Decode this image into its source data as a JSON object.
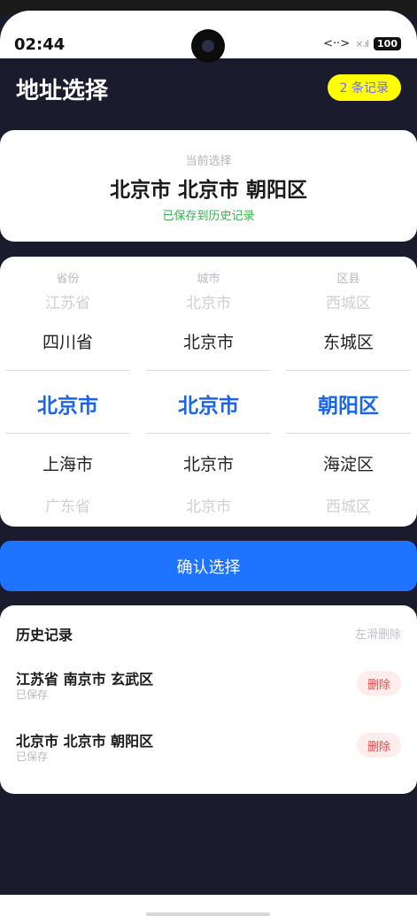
{
  "status_bar": {
    "time": "02:44",
    "battery": "100",
    "network": "<··>",
    "signal": "×.ıl"
  },
  "header": {
    "title": "地址选择",
    "record_badge": "2 条记录"
  },
  "current": {
    "label": "当前选择",
    "value": "北京市 北京市 朝阳区",
    "saved_note": "已保存到历史记录"
  },
  "picker": {
    "province": {
      "header": "省份",
      "options": [
        "江苏省",
        "四川省",
        "北京市",
        "上海市",
        "广东省"
      ]
    },
    "city": {
      "header": "城市",
      "options": [
        "北京市",
        "北京市",
        "北京市",
        "北京市",
        "北京市"
      ]
    },
    "district": {
      "header": "区县",
      "options": [
        "西城区",
        "东城区",
        "朝阳区",
        "海淀区",
        "西城区"
      ]
    }
  },
  "confirm_label": "确认选择",
  "history": {
    "title": "历史记录",
    "hint": "左滑删除",
    "items": [
      {
        "address": "江苏省 南京市 玄武区",
        "status": "已保存",
        "delete_label": "删除"
      },
      {
        "address": "北京市 北京市 朝阳区",
        "status": "已保存",
        "delete_label": "删除"
      }
    ]
  },
  "colors": {
    "accent": "#1f74ff",
    "selected_text": "#1a66e6",
    "badge": "#ffff00",
    "background": "#1b1b2e"
  }
}
